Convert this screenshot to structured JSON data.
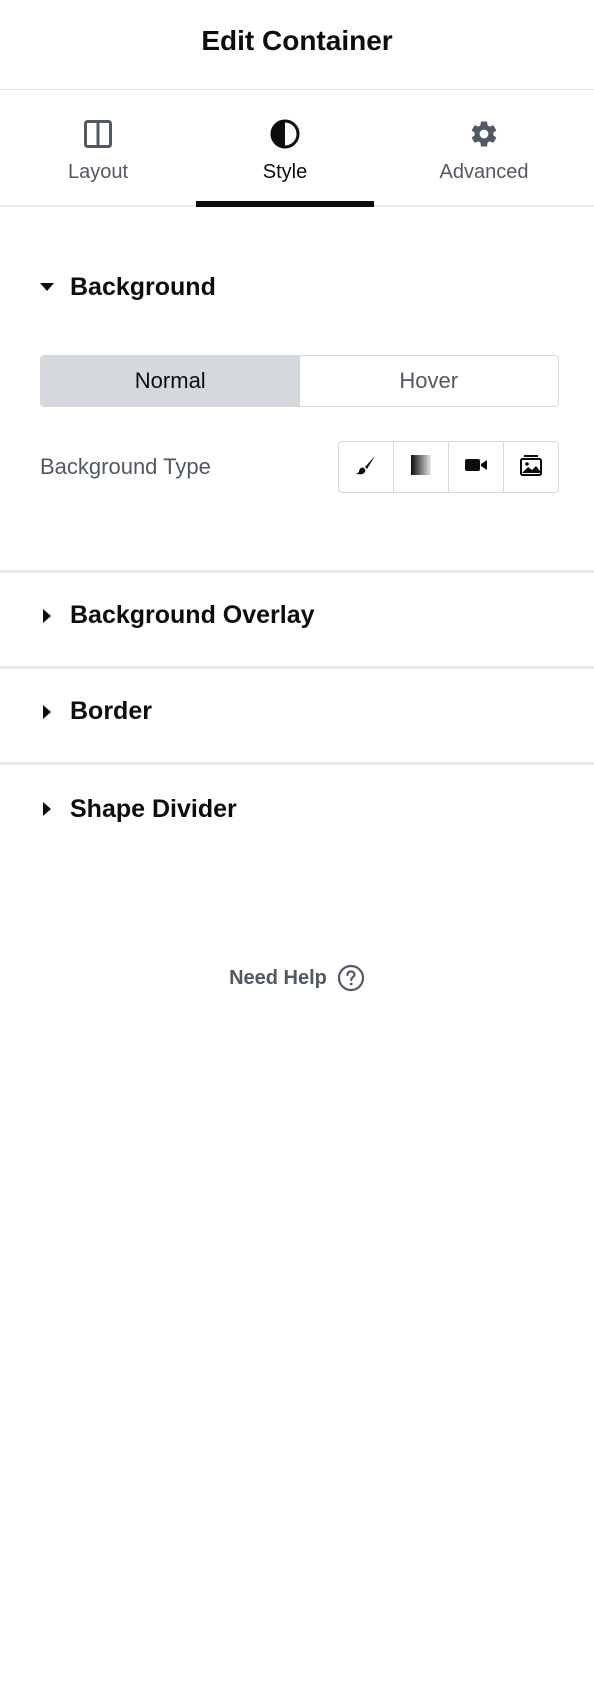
{
  "header": {
    "title": "Edit Container"
  },
  "tabs": [
    {
      "label": "Layout",
      "icon": "layout-columns-icon",
      "active": false
    },
    {
      "label": "Style",
      "icon": "half-circle-icon",
      "active": true
    },
    {
      "label": "Advanced",
      "icon": "gear-icon",
      "active": false
    }
  ],
  "background": {
    "title": "Background",
    "expanded": true,
    "state_toggle": {
      "normal": "Normal",
      "hover": "Hover",
      "selected": "Normal"
    },
    "type_label": "Background Type",
    "type_options": [
      "brush-icon",
      "gradient-icon",
      "video-icon",
      "slideshow-icon"
    ]
  },
  "sections": [
    {
      "title": "Background Overlay"
    },
    {
      "title": "Border"
    },
    {
      "title": "Shape Divider"
    }
  ],
  "help": {
    "label": "Need Help"
  },
  "colors": {
    "text_primary": "#0c0d0e",
    "text_secondary": "#515962",
    "border": "#d5d8dc",
    "divider": "#e6e8ea"
  }
}
